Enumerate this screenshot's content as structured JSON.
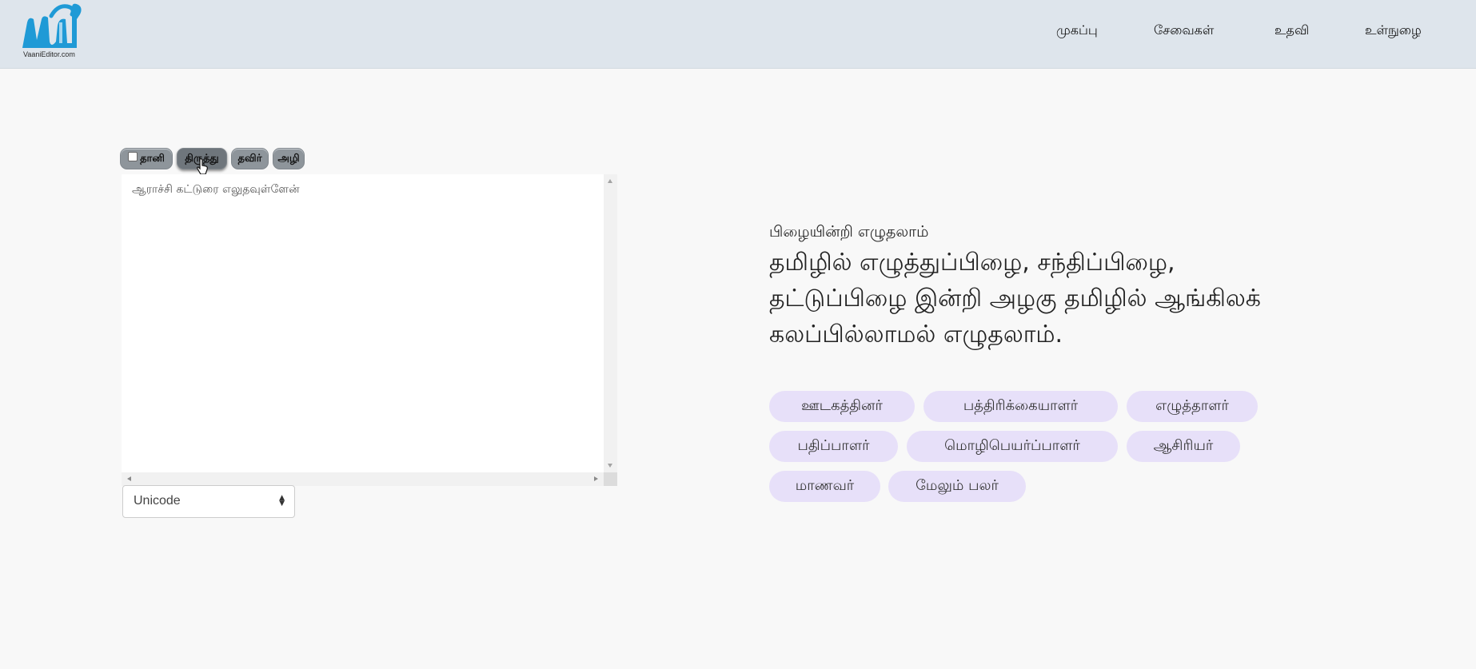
{
  "header": {
    "logo_alt": "வாணி",
    "logo_caption": "VaaniEditor.com",
    "nav": [
      "முகப்பு",
      "சேவைகள்",
      "உதவி",
      "உள்நுழை"
    ]
  },
  "toolbar": {
    "auto_checkbox_checked": false,
    "buttons": [
      "தானி",
      "திருத்து",
      "தவிர்",
      "அழி"
    ]
  },
  "editor": {
    "content": "ஆராச்சி கட்டுரை எலுதவுள்ளேன்"
  },
  "encoding_select": {
    "value": "Unicode"
  },
  "hero": {
    "subtitle": "பிழையின்றி எழுதலாம்",
    "title": "தமிழில் எழுத்துப்பிழை, சந்திப்பிழை, தட்டுப்பிழை இன்றி அழகு தமிழில் ஆங்கிலக் கலப்பில்லாமல் எழுதலாம்.",
    "tags": [
      "ஊடகத்தினர்",
      "பத்திரிக்கையாளர்",
      "எழுத்தாளர்",
      "பதிப்பாளர்",
      "மொழிபெயர்ப்பாளர்",
      "ஆசிரியர்",
      "மாணவர்",
      "மேலும் பலர்"
    ]
  },
  "colors": {
    "header_bg": "#dee5ec",
    "logo_blue": "#1f9ad6",
    "tag_bg": "#e7e0f9",
    "toolbar_btn": "#8e959b"
  }
}
